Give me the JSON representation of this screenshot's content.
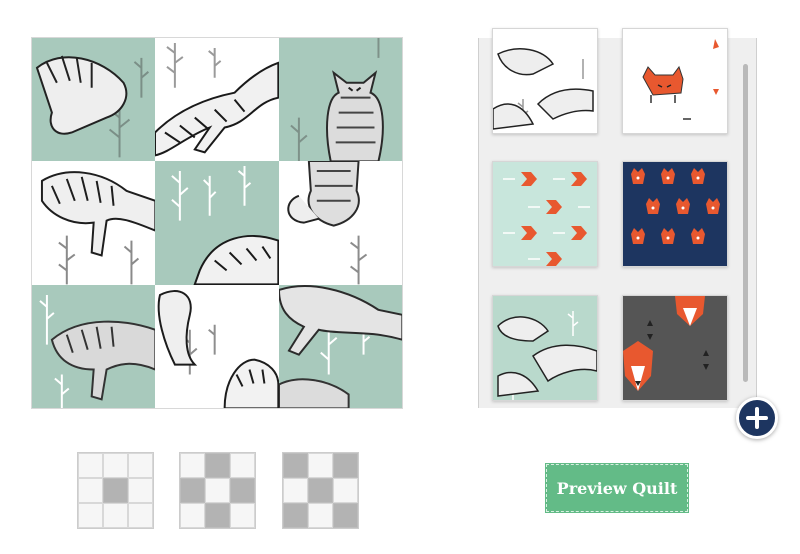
{
  "colors": {
    "mint": "#a8c9bc",
    "navy": "#1d3560",
    "fox_orange": "#e8582f",
    "charcoal": "#555555",
    "button_green": "#63bb87"
  },
  "quilt": {
    "cells": [
      "mint",
      "white",
      "mint",
      "white",
      "mint",
      "white",
      "mint",
      "white",
      "mint"
    ]
  },
  "swatches": [
    {
      "name": "sketched-fox-on-white"
    },
    {
      "name": "orange-fox-on-white"
    },
    {
      "name": "orange-arrows-on-mint"
    },
    {
      "name": "orange-foxes-on-navy"
    },
    {
      "name": "sketched-fox-on-mint"
    },
    {
      "name": "geometric-fox-on-charcoal"
    }
  ],
  "actions": {
    "add_icon": "plus-icon",
    "preview_label": "Preview Quilt"
  },
  "layouts": [
    {
      "pattern": [
        0,
        0,
        0,
        0,
        1,
        0,
        0,
        0,
        0
      ]
    },
    {
      "pattern": [
        0,
        1,
        0,
        1,
        0,
        1,
        0,
        1,
        0
      ]
    },
    {
      "pattern": [
        1,
        0,
        1,
        0,
        1,
        0,
        1,
        0,
        1
      ]
    }
  ]
}
